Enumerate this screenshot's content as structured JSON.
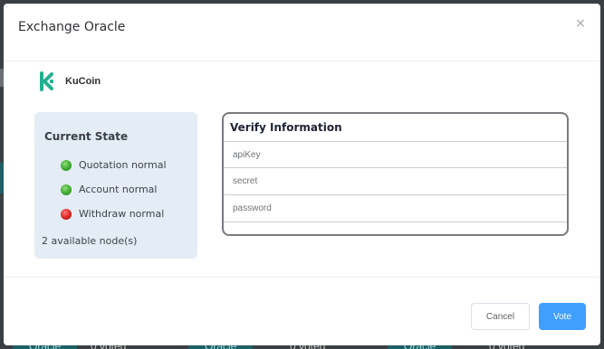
{
  "background": {
    "items": [
      {
        "tag": "Oracle",
        "votes": "0 voted"
      },
      {
        "tag": "Oracle",
        "votes": "0 voted"
      },
      {
        "tag": "Oracle",
        "votes": "0 voted"
      }
    ]
  },
  "modal": {
    "title": "Exchange Oracle",
    "close_icon": "×",
    "exchange": {
      "icon": "kucoin-logo-icon",
      "name": "KuCoin"
    },
    "state": {
      "title": "Current State",
      "items": [
        {
          "label": "Quotation normal",
          "status": "green"
        },
        {
          "label": "Account normal",
          "status": "green"
        },
        {
          "label": "Withdraw normal",
          "status": "red"
        }
      ],
      "nodes": "2 available node(s)"
    },
    "verify": {
      "title": "Verify Information",
      "fields": [
        {
          "placeholder": "apiKey",
          "value": ""
        },
        {
          "placeholder": "secret",
          "value": ""
        },
        {
          "placeholder": "password",
          "value": ""
        }
      ]
    },
    "buttons": {
      "cancel": "Cancel",
      "vote": "Vote"
    }
  },
  "colors": {
    "primary": "#409eff",
    "status_green": "#3ca92e",
    "status_red": "#d9211f",
    "state_panel": "#e4ecf6"
  }
}
